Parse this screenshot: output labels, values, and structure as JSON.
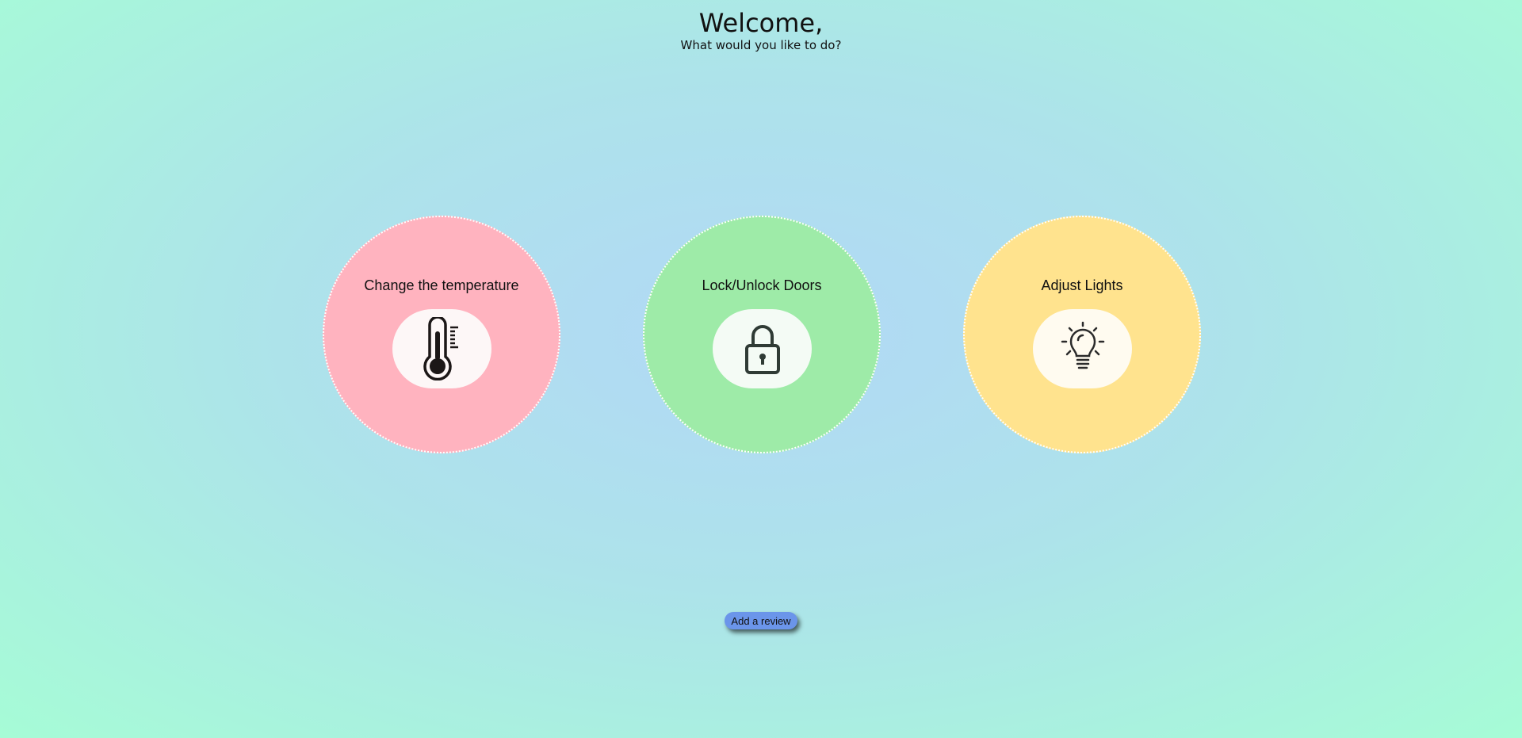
{
  "header": {
    "title": "Welcome,",
    "subtitle": "What would you like to do?"
  },
  "cards": [
    {
      "label": "Change the temperature",
      "icon": "thermometer-icon",
      "color": "#ffb3bf",
      "pill": "#fdf7f7"
    },
    {
      "label": "Lock/Unlock Doors",
      "icon": "padlock-icon",
      "color": "#9eeba8",
      "pill": "#f4fbf5"
    },
    {
      "label": "Adjust Lights",
      "icon": "lightbulb-icon",
      "color": "#ffe38e",
      "pill": "#fffbf0"
    }
  ],
  "review_button": {
    "label": "Add a review",
    "color": "#6b95ea"
  }
}
